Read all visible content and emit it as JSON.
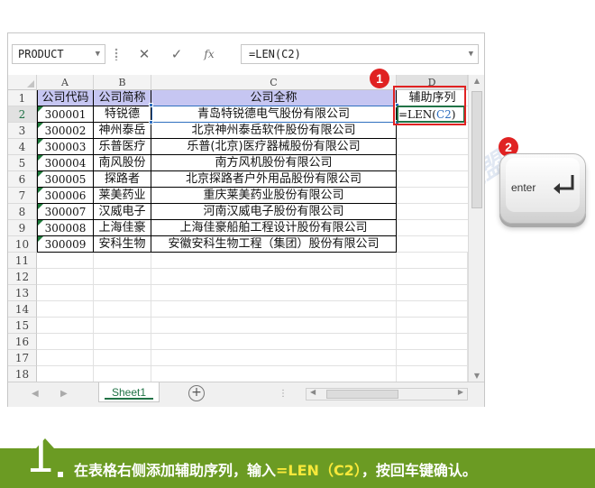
{
  "formula_bar": {
    "name_box": "PRODUCT",
    "cancel_icon": "✕",
    "enter_icon": "✓",
    "fx_label": "fx",
    "formula": "=LEN(C2)"
  },
  "columns": [
    "A",
    "B",
    "C",
    "D"
  ],
  "row_numbers": [
    "1",
    "2",
    "3",
    "4",
    "5",
    "6",
    "7",
    "8",
    "9",
    "10",
    "11",
    "12",
    "13",
    "14",
    "15",
    "16",
    "17",
    "18"
  ],
  "header_row": {
    "a": "公司代码",
    "b": "公司简称",
    "c": "公司全称",
    "d": "辅助序列"
  },
  "rows": [
    {
      "code": "300001",
      "short": "特锐德",
      "full": "青岛特锐德电气股份有限公司"
    },
    {
      "code": "300002",
      "short": "神州泰岳",
      "full": "北京神州泰岳软件股份有限公司"
    },
    {
      "code": "300003",
      "short": "乐普医疗",
      "full": "乐普(北京)医疗器械股份有限公司"
    },
    {
      "code": "300004",
      "short": "南风股份",
      "full": "南方风机股份有限公司"
    },
    {
      "code": "300005",
      "short": "探路者",
      "full": "北京探路者户外用品股份有限公司"
    },
    {
      "code": "300006",
      "short": "莱美药业",
      "full": "重庆莱美药业股份有限公司"
    },
    {
      "code": "300007",
      "short": "汉威电子",
      "full": "河南汉威电子股份有限公司"
    },
    {
      "code": "300008",
      "short": "上海佳豪",
      "full": "上海佳豪船舶工程设计股份有限公司"
    },
    {
      "code": "300009",
      "short": "安科生物",
      "full": "安徽安科生物工程（集团）股份有限公司"
    }
  ],
  "editing_cell": {
    "prefix": "=LEN(",
    "ref": "C2",
    "suffix": ")"
  },
  "sheet_tab": "Sheet1",
  "badges": {
    "one": "1",
    "two": "2"
  },
  "enter_key_label": "enter",
  "watermark": "Word联盟",
  "step": {
    "number": "1",
    "text_before": "在表格右侧添加辅助序列，输入",
    "highlight": "=LEN（C2）",
    "text_after": "，按回车键确认。"
  },
  "colors": {
    "header_fill": "#c6c6f2",
    "selection": "#217346",
    "highlight_box": "#e02222",
    "banner": "#6b9b23",
    "highlight_text": "#f7e83a",
    "ref_blue": "#2f6fbf"
  }
}
